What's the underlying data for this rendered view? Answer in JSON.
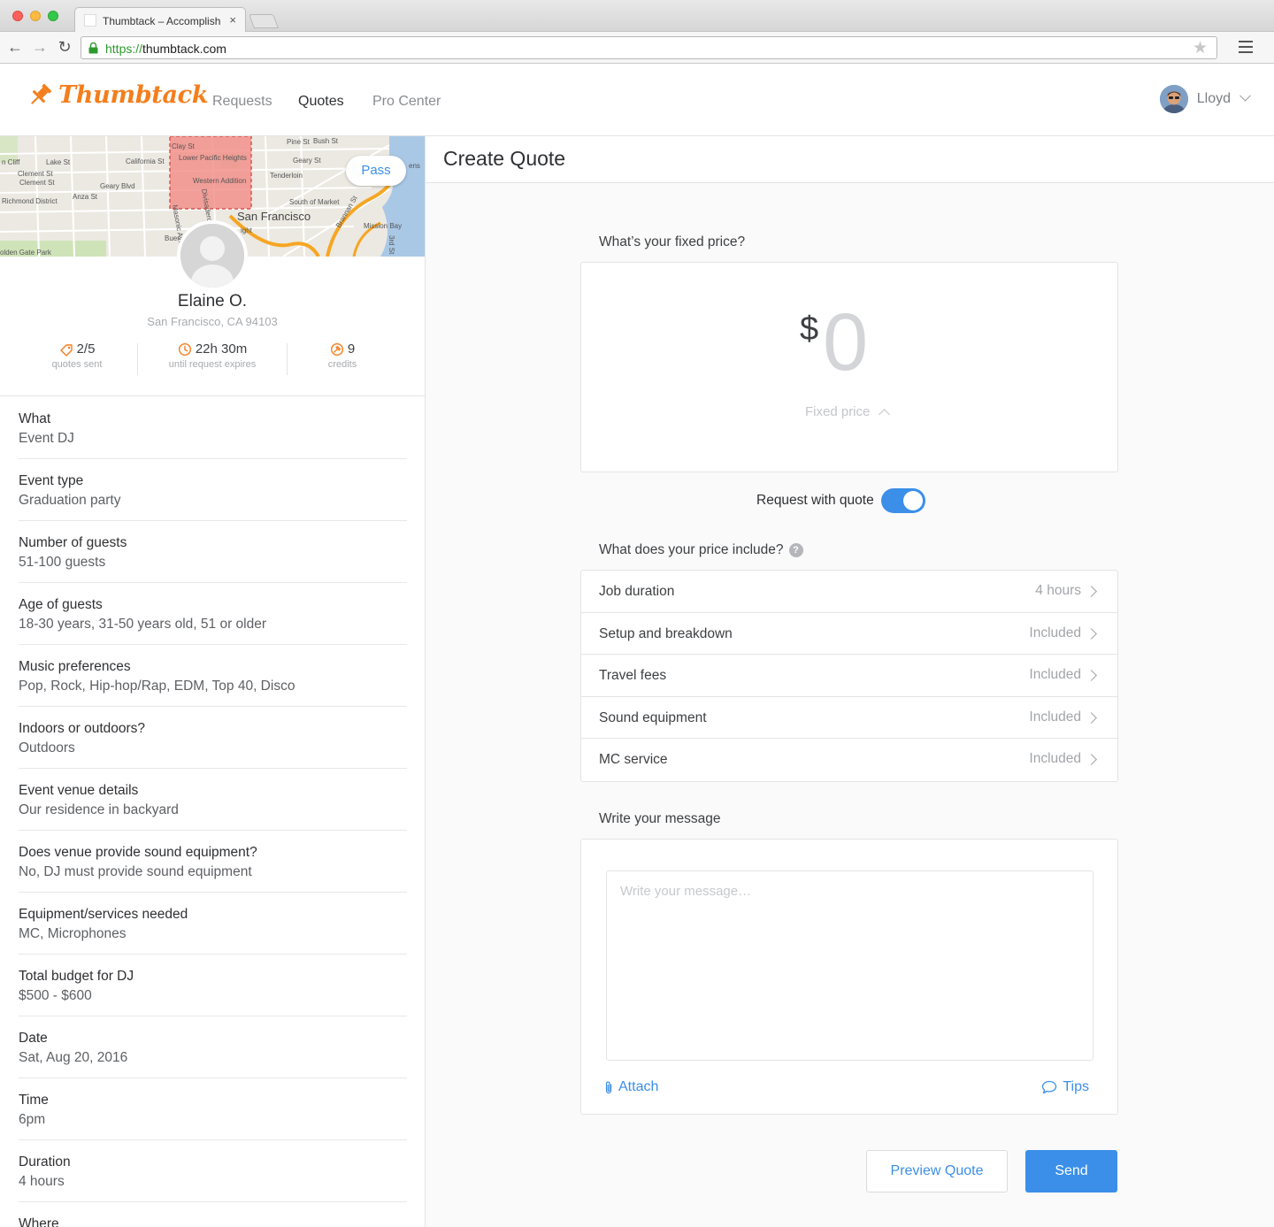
{
  "browser": {
    "tab_title": "Thumbtack – Accomplish",
    "tab_close": "×",
    "url_scheme": "https://",
    "url_host": "thumbtack.com"
  },
  "header": {
    "logo_text": "Thumbtack",
    "nav": [
      "Requests",
      "Quotes",
      "Pro Center"
    ],
    "active_nav": "Quotes",
    "user_name": "Lloyd"
  },
  "map": {
    "pass_label": "Pass",
    "labels": [
      "Lake St",
      "California St",
      "Clement St",
      "Geary Blvd",
      "Anza St",
      "Richmond District",
      "Clay St",
      "Lower Pacific Heights",
      "Western Addition",
      "Pine St",
      "Bush St",
      "Geary St",
      "Tenderloin",
      "South of Market",
      "San Francisco",
      "Mission Bay",
      "olden Gate Park",
      "Buer",
      "ight",
      "Divisadero",
      "Masonic Ave",
      "Brannan St",
      "3rd St",
      "ens",
      "n Cliff"
    ],
    "accent_color": "#f47e1c",
    "highlight_color": "#f28b86"
  },
  "profile": {
    "name": "Elaine O.",
    "location": "San Francisco, CA 94103",
    "stats": [
      {
        "icon": "tag-icon",
        "value": "2/5",
        "label": "quotes sent"
      },
      {
        "icon": "clock-icon",
        "value": "22h 30m",
        "label": "until request expires"
      },
      {
        "icon": "pin-icon",
        "value": "9",
        "label": "credits"
      }
    ]
  },
  "details": [
    {
      "label": "What",
      "value": "Event DJ"
    },
    {
      "label": "Event type",
      "value": "Graduation party"
    },
    {
      "label": "Number of guests",
      "value": "51-100 guests"
    },
    {
      "label": "Age of guests",
      "value": "18-30 years, 31-50 years old, 51 or older"
    },
    {
      "label": "Music preferences",
      "value": "Pop, Rock, Hip-hop/Rap, EDM, Top 40, Disco"
    },
    {
      "label": "Indoors or outdoors?",
      "value": "Outdoors"
    },
    {
      "label": "Event venue details",
      "value": "Our residence in backyard"
    },
    {
      "label": "Does venue provide sound equipment?",
      "value": "No, DJ must provide sound equipment"
    },
    {
      "label": "Equipment/services needed",
      "value": "MC, Microphones"
    },
    {
      "label": "Total budget for DJ",
      "value": "$500 - $600"
    },
    {
      "label": "Date",
      "value": "Sat, Aug 20, 2016"
    },
    {
      "label": "Time",
      "value": "6pm"
    },
    {
      "label": "Duration",
      "value": "4 hours"
    },
    {
      "label": "Where",
      "value": ""
    }
  ],
  "quote": {
    "title": "Create Quote",
    "price_question": "What’s your fixed price?",
    "currency": "$",
    "price_value": "0",
    "price_label": "Fixed price",
    "toggle_label": "Request with quote",
    "toggle_on": true,
    "include_question": "What does your price include?",
    "help_glyph": "?",
    "includes": [
      {
        "name": "Job duration",
        "value": "4 hours"
      },
      {
        "name": "Setup and breakdown",
        "value": "Included"
      },
      {
        "name": "Travel fees",
        "value": "Included"
      },
      {
        "name": "Sound equipment",
        "value": "Included"
      },
      {
        "name": "MC service",
        "value": "Included"
      }
    ],
    "message_title": "Write your message",
    "message_placeholder": "Write your message…",
    "attach_label": "Attach",
    "tips_label": "Tips",
    "preview_label": "Preview Quote",
    "send_label": "Send",
    "primary_color": "#3b8fe8"
  }
}
